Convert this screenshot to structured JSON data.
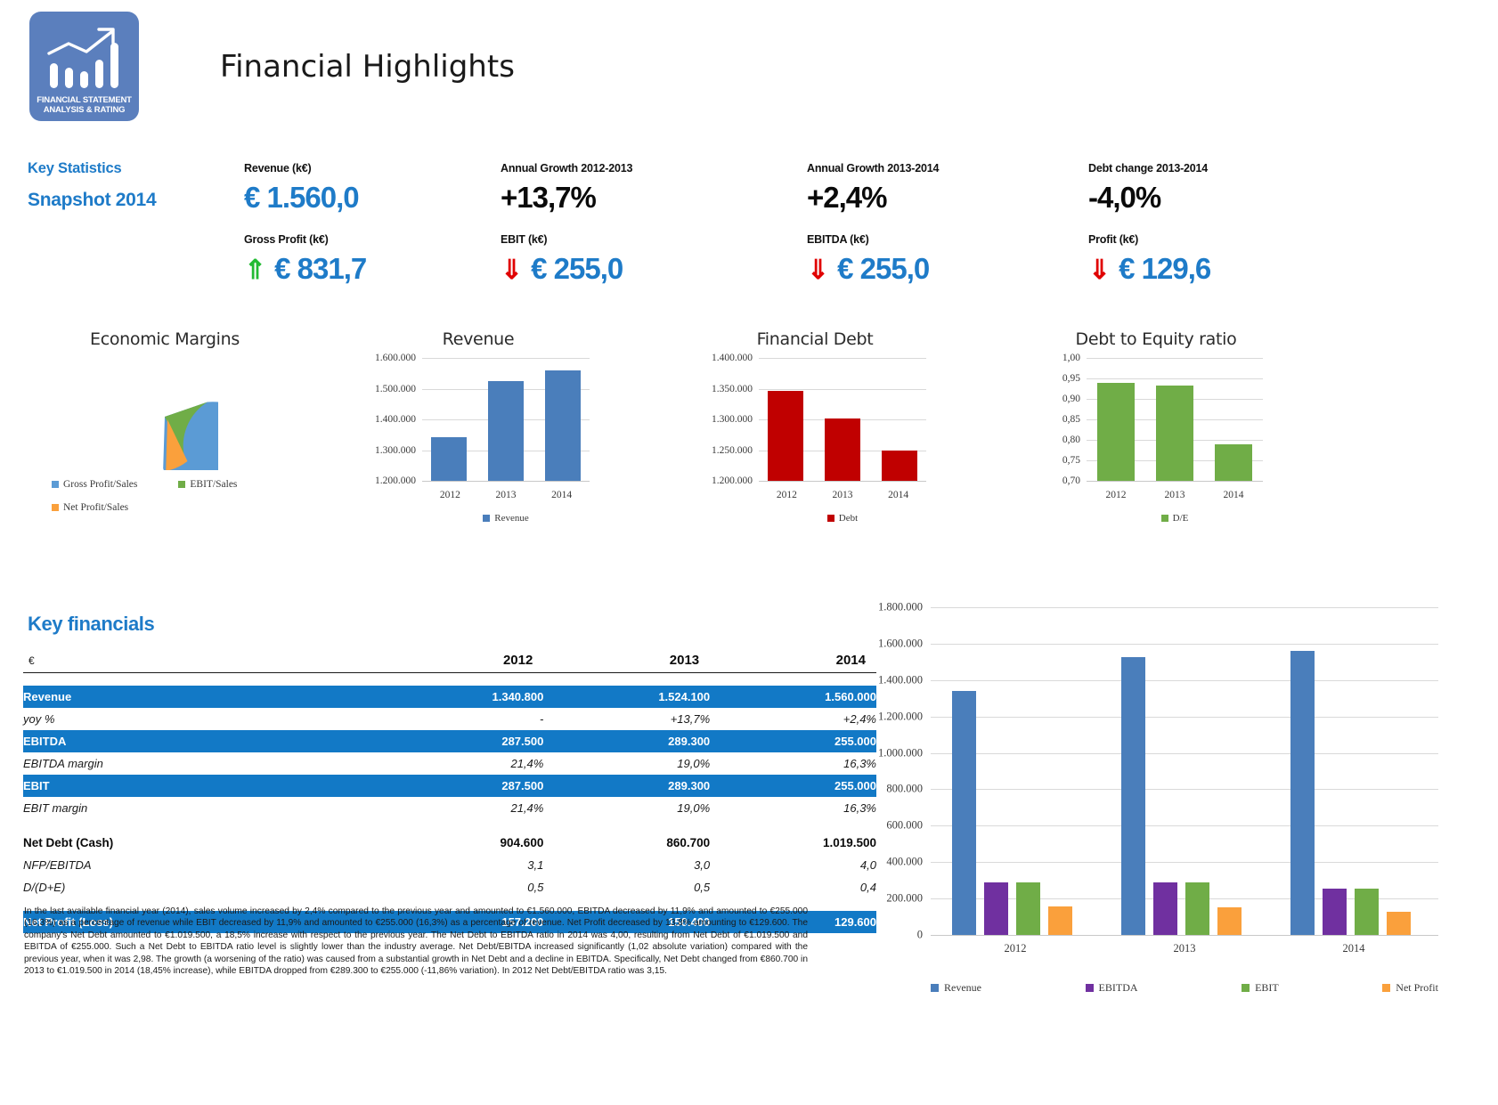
{
  "header": {
    "title": "Financial Highlights",
    "logo": {
      "caption_line1": "FINANCIAL STATEMENT",
      "caption_line2": "ANALYSIS & RATING",
      "icon": "bar-chart-growth-icon",
      "bg_color": "#5b7fbd"
    }
  },
  "key_statistics": {
    "heading": "Key Statistics",
    "subheading": "Snapshot 2014",
    "accent_color": "#1e7bc8",
    "kpis_row1": [
      {
        "label": "Revenue (k€)",
        "value": "€ 1.560,0",
        "color": "#1e7bc8",
        "arrow": ""
      },
      {
        "label": "Annual Growth 2012-2013",
        "value": "+13,7%",
        "color": "#0a0a0a",
        "arrow": ""
      },
      {
        "label": "Annual Growth 2013-2014",
        "value": "+2,4%",
        "color": "#0a0a0a",
        "arrow": ""
      },
      {
        "label": "Debt change 2013-2014",
        "value": "-4,0%",
        "color": "#0a0a0a",
        "arrow": ""
      }
    ],
    "kpis_row2": [
      {
        "label": "Gross Profit (k€)",
        "value": "€ 831,7",
        "color": "#1e7bc8",
        "arrow": "up",
        "arrow_glyph": "⇑",
        "arrow_color": "#22bb33"
      },
      {
        "label": "EBIT (k€)",
        "value": "€ 255,0",
        "color": "#1e7bc8",
        "arrow": "down",
        "arrow_glyph": "⇓",
        "arrow_color": "#e00000"
      },
      {
        "label": "EBITDA (k€)",
        "value": "€ 255,0",
        "color": "#1e7bc8",
        "arrow": "down",
        "arrow_glyph": "⇓",
        "arrow_color": "#e00000"
      },
      {
        "label": "Profit (k€)",
        "value": "€ 129,6",
        "color": "#1e7bc8",
        "arrow": "down",
        "arrow_glyph": "⇓",
        "arrow_color": "#e00000"
      }
    ]
  },
  "key_financials": {
    "heading": "Key financials",
    "unit_header": "€",
    "years": [
      "2012",
      "2013",
      "2014"
    ],
    "rows": [
      {
        "label": "Revenue",
        "style": "blue",
        "values": [
          "1.340.800",
          "1.524.100",
          "1.560.000"
        ]
      },
      {
        "label": "yoy %",
        "style": "italic",
        "values": [
          "-",
          "+13,7%",
          "+2,4%"
        ]
      },
      {
        "label": "EBITDA",
        "style": "blue",
        "values": [
          "287.500",
          "289.300",
          "255.000"
        ]
      },
      {
        "label": "EBITDA margin",
        "style": "italic",
        "values": [
          "21,4%",
          "19,0%",
          "16,3%"
        ]
      },
      {
        "label": "EBIT",
        "style": "blue",
        "values": [
          "287.500",
          "289.300",
          "255.000"
        ]
      },
      {
        "label": "EBIT margin",
        "style": "italic",
        "values": [
          "21,4%",
          "19,0%",
          "16,3%"
        ]
      },
      {
        "label": "Net Debt (Cash)",
        "style": "bold",
        "values": [
          "904.600",
          "860.700",
          "1.019.500"
        ]
      },
      {
        "label": "NFP/EBITDA",
        "style": "italic",
        "values": [
          "3,1",
          "3,0",
          "4,0"
        ]
      },
      {
        "label": "D/(D+E)",
        "style": "italic",
        "values": [
          "0,5",
          "0,5",
          "0,4"
        ]
      },
      {
        "label": "Net Profit (Loss)",
        "style": "blue",
        "values": [
          "157.200",
          "150.400",
          "129.600"
        ]
      }
    ],
    "narrative": "In the last available financial year (2014), sales volume increased by 2,4% compared to the previous year and amounted to €1.560.000, EBITDA decreased by 11,9% and amounted to €255.000 (16,3%) as a percentage of revenue while EBIT decreased by 11,9% and amounted to €255.000 (16,3%) as a percentage of revenue. Net Profit decreased by 13,8% amounting to €129.600. The company's Net Debt amounted to €1.019.500, a 18,5% increase with respect to the previous year. The Net Debt to EBITDA ratio in 2014 was 4,00, resulting from Net Debt of €1.019.500 and EBITDA of €255.000. Such a Net Debt to EBITDA ratio level is slightly lower than the industry average. Net Debt/EBITDA increased significantly (1,02 absolute variation) compared with the previous year, when it was 2,98. The growth (a worsening of the ratio) was caused from a substantial growth in Net Debt and a decline in EBITDA. Specifically, Net Debt changed from €860.700 in 2013 to €1.019.500 in 2014 (18,45% increase), while EBITDA  dropped from €289.300 to €255.000 (-11,86% variation). In 2012 Net Debt/EBITDA ratio was 3,15."
  },
  "chart_data": [
    {
      "id": "economic-margins",
      "type": "pie",
      "title": "Economic Margins",
      "labels": [
        "Gross Profit/Sales",
        "EBIT/Sales",
        "Net Profit/Sales"
      ],
      "values": [
        53.3,
        16.3,
        8.3
      ],
      "percentages": [
        68.4,
        20.9,
        10.7
      ],
      "colors": [
        "#5b9bd5",
        "#70ad47",
        "#faa03c"
      ],
      "legend_position": "bottom",
      "exploded_slice": "Net Profit/Sales"
    },
    {
      "id": "revenue",
      "type": "bar",
      "title": "Revenue",
      "categories": [
        "2012",
        "2013",
        "2014"
      ],
      "series": [
        {
          "name": "Revenue",
          "values": [
            1340800,
            1524100,
            1560000
          ]
        }
      ],
      "yticks": [
        "1.200.000",
        "1.300.000",
        "1.400.000",
        "1.500.000",
        "1.600.000"
      ],
      "ylim": [
        1200000,
        1600000
      ],
      "color": "#4a7ebb",
      "legend": [
        "Revenue"
      ],
      "grid": true
    },
    {
      "id": "financial-debt",
      "type": "bar",
      "title": "Financial Debt",
      "categories": [
        "2012",
        "2013",
        "2014"
      ],
      "series": [
        {
          "name": "Debt",
          "values": [
            1347000,
            1301500,
            1250000
          ]
        }
      ],
      "yticks": [
        "1.200.000",
        "1.250.000",
        "1.300.000",
        "1.350.000",
        "1.400.000"
      ],
      "ylim": [
        1200000,
        1400000
      ],
      "color": "#c00000",
      "legend": [
        "Debt"
      ],
      "grid": true
    },
    {
      "id": "debt-to-equity",
      "type": "bar",
      "title": "Debt to Equity ratio",
      "categories": [
        "2012",
        "2013",
        "2014"
      ],
      "series": [
        {
          "name": "D/E",
          "values": [
            0.94,
            0.933,
            0.79
          ]
        }
      ],
      "yticks": [
        "0,70",
        "0,75",
        "0,80",
        "0,85",
        "0,90",
        "0,95",
        "1,00"
      ],
      "ylim": [
        0.7,
        1.0
      ],
      "color": "#70ad47",
      "legend": [
        "D/E"
      ],
      "grid": true
    },
    {
      "id": "key-financials-bars",
      "type": "bar",
      "title": "",
      "categories": [
        "2012",
        "2013",
        "2014"
      ],
      "series": [
        {
          "name": "Revenue",
          "values": [
            1340800,
            1524100,
            1560000
          ],
          "color": "#4a7ebb"
        },
        {
          "name": "EBITDA",
          "values": [
            287500,
            289300,
            255000
          ],
          "color": "#7030a0"
        },
        {
          "name": "EBIT",
          "values": [
            287500,
            289300,
            255000
          ],
          "color": "#70ad47"
        },
        {
          "name": "Net Profit",
          "values": [
            157200,
            150400,
            129600
          ],
          "color": "#faa03c"
        }
      ],
      "yticks": [
        "0",
        "200.000",
        "400.000",
        "600.000",
        "800.000",
        "1.000.000",
        "1.200.000",
        "1.400.000",
        "1.600.000",
        "1.800.000"
      ],
      "ylim": [
        0,
        1800000
      ],
      "legend": [
        "Revenue",
        "EBITDA",
        "EBIT",
        "Net Profit"
      ],
      "legend_position": "bottom",
      "grid": true
    }
  ]
}
